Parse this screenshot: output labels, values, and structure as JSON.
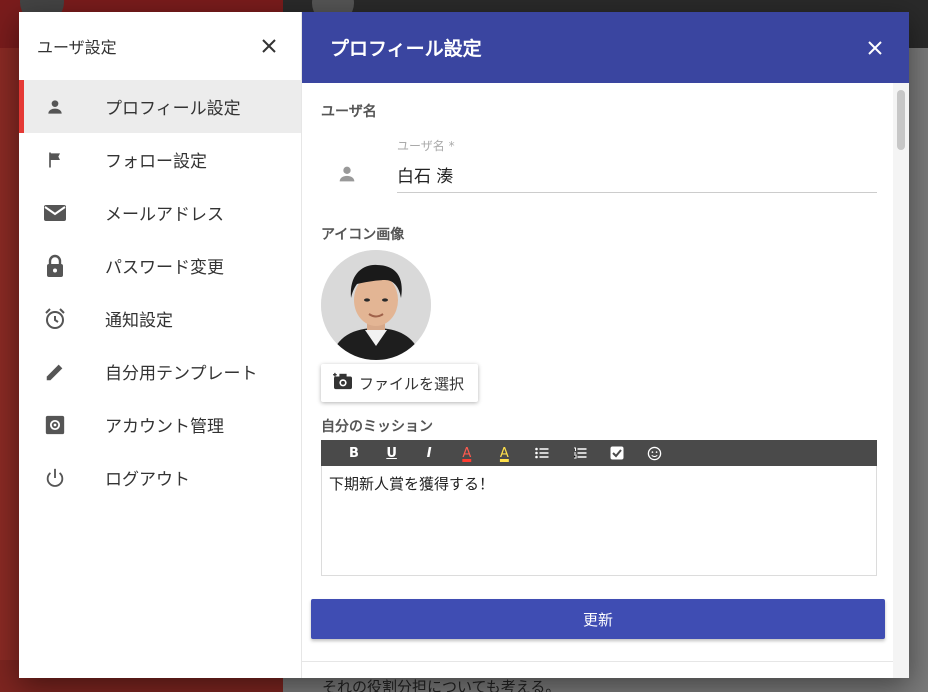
{
  "background": {
    "bottom_text": "それの役割分担についても考える。"
  },
  "sidebar": {
    "title": "ユーザ設定",
    "items": [
      {
        "label": "プロフィール設定",
        "icon": "person-icon",
        "active": true
      },
      {
        "label": "フォロー設定",
        "icon": "flag-icon",
        "active": false
      },
      {
        "label": "メールアドレス",
        "icon": "mail-icon",
        "active": false
      },
      {
        "label": "パスワード変更",
        "icon": "lock-icon",
        "active": false
      },
      {
        "label": "通知設定",
        "icon": "alarm-icon",
        "active": false
      },
      {
        "label": "自分用テンプレート",
        "icon": "pencil-icon",
        "active": false
      },
      {
        "label": "アカウント管理",
        "icon": "settings-box-icon",
        "active": false
      },
      {
        "label": "ログアウト",
        "icon": "power-icon",
        "active": false
      }
    ]
  },
  "profile": {
    "title": "プロフィール設定",
    "username_section": "ユーザ名",
    "username_field_label": "ユーザ名 *",
    "username_value": "白石 湊",
    "icon_section": "アイコン画像",
    "file_button": "ファイルを選択",
    "mission_section": "自分のミッション",
    "toolbar": [
      "B",
      "U",
      "I",
      "A",
      "A",
      "bulleted-list",
      "numbered-list",
      "checkbox",
      "emoji"
    ],
    "mission_text": "下期新人賞を獲得する！",
    "update_button": "更新"
  },
  "colors": {
    "header_bg": "#3a45a0",
    "accent_red": "#e53935",
    "button_bg": "#3f4db3",
    "toolbar_bg": "#4a4a4a"
  }
}
